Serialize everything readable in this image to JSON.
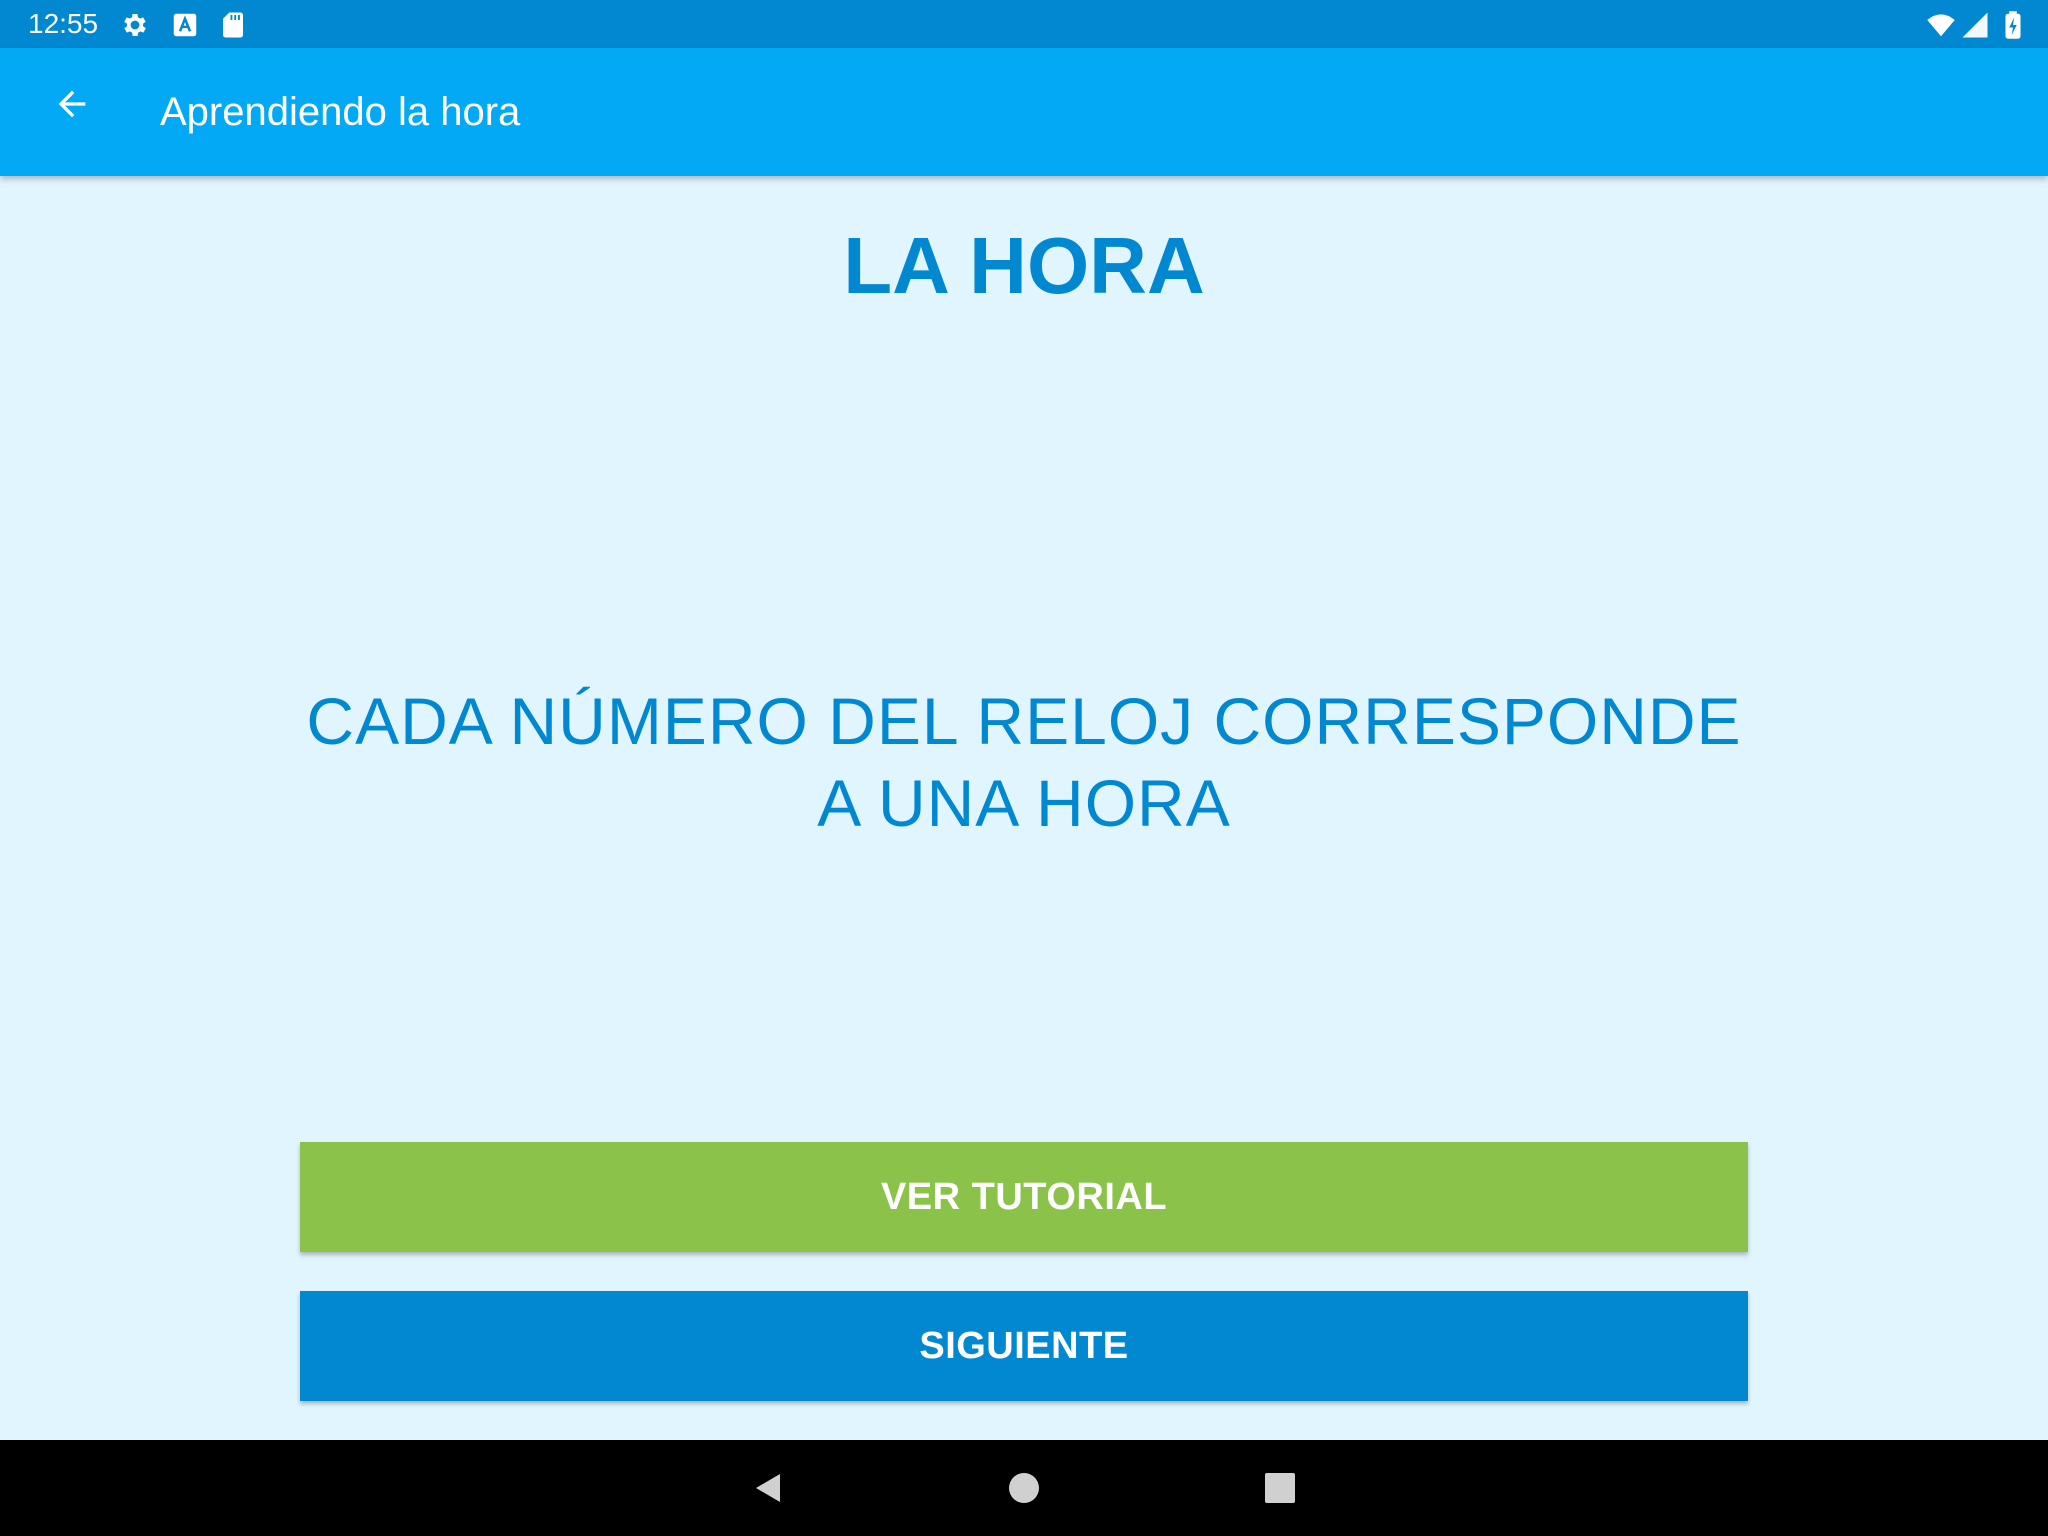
{
  "status_bar": {
    "time": "12:55",
    "icons": [
      "settings-icon",
      "a-notification-icon",
      "sd-card-icon",
      "wifi-icon",
      "signal-icon",
      "battery-charging-icon"
    ]
  },
  "app_bar": {
    "title": "Aprendiendo la hora",
    "back_icon": "arrow-back-icon"
  },
  "main": {
    "heading": "LA HORA",
    "lesson_text": "CADA NÚMERO DEL RELOJ CORRESPONDE A UNA HORA"
  },
  "buttons": {
    "tutorial_label": "VER TUTORIAL",
    "next_label": "SIGUIENTE"
  },
  "nav_bar": {
    "icons": [
      "nav-back-icon",
      "nav-home-icon",
      "nav-recents-icon"
    ]
  },
  "colors": {
    "status_bar": "#0288d1",
    "app_bar": "#03a9f4",
    "background": "#e1f5fe",
    "text_accent": "#0288d1",
    "tutorial_button": "#8bc34a",
    "next_button": "#0288d1"
  }
}
